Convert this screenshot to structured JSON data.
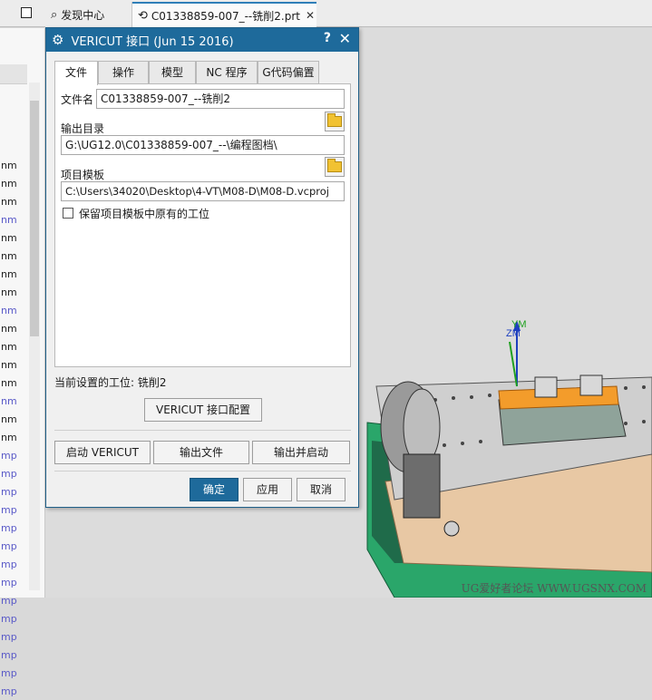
{
  "tabs": [
    {
      "label": "发现中心"
    },
    {
      "label": "C01338859-007_--铣削2.prt"
    }
  ],
  "left_rows": [
    "nm",
    "nm",
    "nm",
    "nm",
    "nm",
    "nm",
    "nm",
    "nm",
    "nm",
    "nm",
    "nm",
    "nm",
    "nm",
    "nm",
    "nm",
    "nm",
    "mp",
    "mp",
    "mp",
    "mp",
    "mp",
    "mp",
    "mp",
    "mp",
    "mp",
    "mp",
    "mp",
    "mp",
    "mp",
    "mp"
  ],
  "dialog": {
    "title": "VERICUT 接口 (Jun 15 2016)",
    "help": "?",
    "close": "✕",
    "tabs": [
      "文件",
      "操作",
      "模型",
      "NC 程序",
      "G代码偏置"
    ],
    "file_name_label": "文件名",
    "file_name_value": "C01338859-007_--铣削2",
    "output_dir_label": "输出目录",
    "output_dir_value": "G:\\UG12.0\\C01338859-007_--\\编程图档\\",
    "template_label": "项目模板",
    "template_value": "C:\\Users\\34020\\Desktop\\4-VT\\M08-D\\M08-D.vcproj",
    "keep_setup_label": "保留项目模板中原有的工位",
    "current_setup": "当前设置的工位: 铣削2",
    "config_button": "VERICUT 接口配置",
    "start_button": "启动 VERICUT",
    "export_button": "输出文件",
    "export_start_button": "输出并启动",
    "ok_button": "确定",
    "apply_button": "应用",
    "cancel_button": "取消"
  },
  "axis_labels": {
    "y": "YM",
    "z": "ZM"
  },
  "watermark": "UG爱好者论坛 WWW.UGSNX.COM",
  "colors": {
    "accent": "#1e6a9b",
    "table_green": "#2aa66a",
    "fixture_orange": "#f39c2b",
    "base_plate": "#e8c8a4"
  }
}
